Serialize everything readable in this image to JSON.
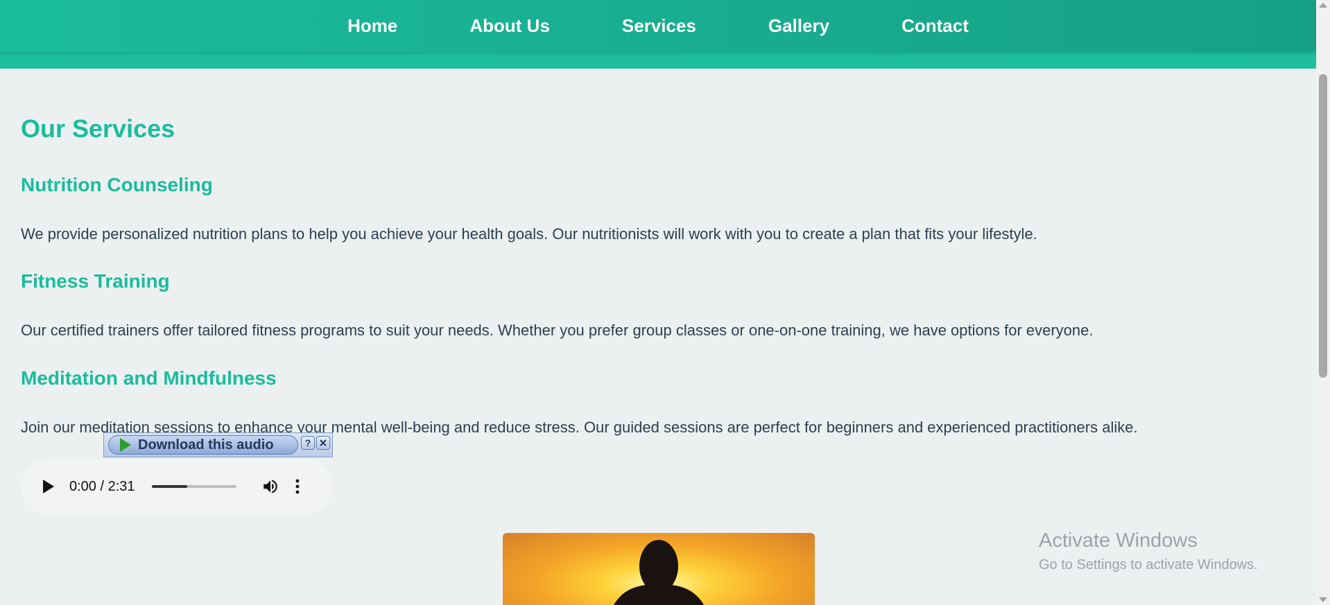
{
  "nav": {
    "items": [
      {
        "label": "Home"
      },
      {
        "label": "About Us"
      },
      {
        "label": "Services"
      },
      {
        "label": "Gallery"
      },
      {
        "label": "Contact"
      }
    ]
  },
  "page": {
    "title": "Our Services"
  },
  "services": [
    {
      "title": "Nutrition Counseling",
      "description": "We provide personalized nutrition plans to help you achieve your health goals. Our nutritionists will work with you to create a plan that fits your lifestyle."
    },
    {
      "title": "Fitness Training",
      "description": "Our certified trainers offer tailored fitness programs to suit your needs. Whether you prefer group classes or one-on-one training, we have options for everyone."
    },
    {
      "title": "Meditation and Mindfulness",
      "description": "Join our meditation sessions to enhance your mental well-being and reduce stress. Our guided sessions are perfect for beginners and experienced practitioners alike."
    }
  ],
  "audio": {
    "time_display": "0:00 / 2:31",
    "progress_fraction": 0.42
  },
  "download_bar": {
    "label": "Download this audio",
    "help": "?",
    "icons": [
      "play-arrow-icon",
      "help-icon",
      "close-icon"
    ]
  },
  "watermark": {
    "title": "Activate Windows",
    "subtitle": "Go to Settings to activate Windows."
  },
  "colors": {
    "accent": "#1abc9c",
    "text": "#2c3e50",
    "background": "#ecf0f1"
  }
}
